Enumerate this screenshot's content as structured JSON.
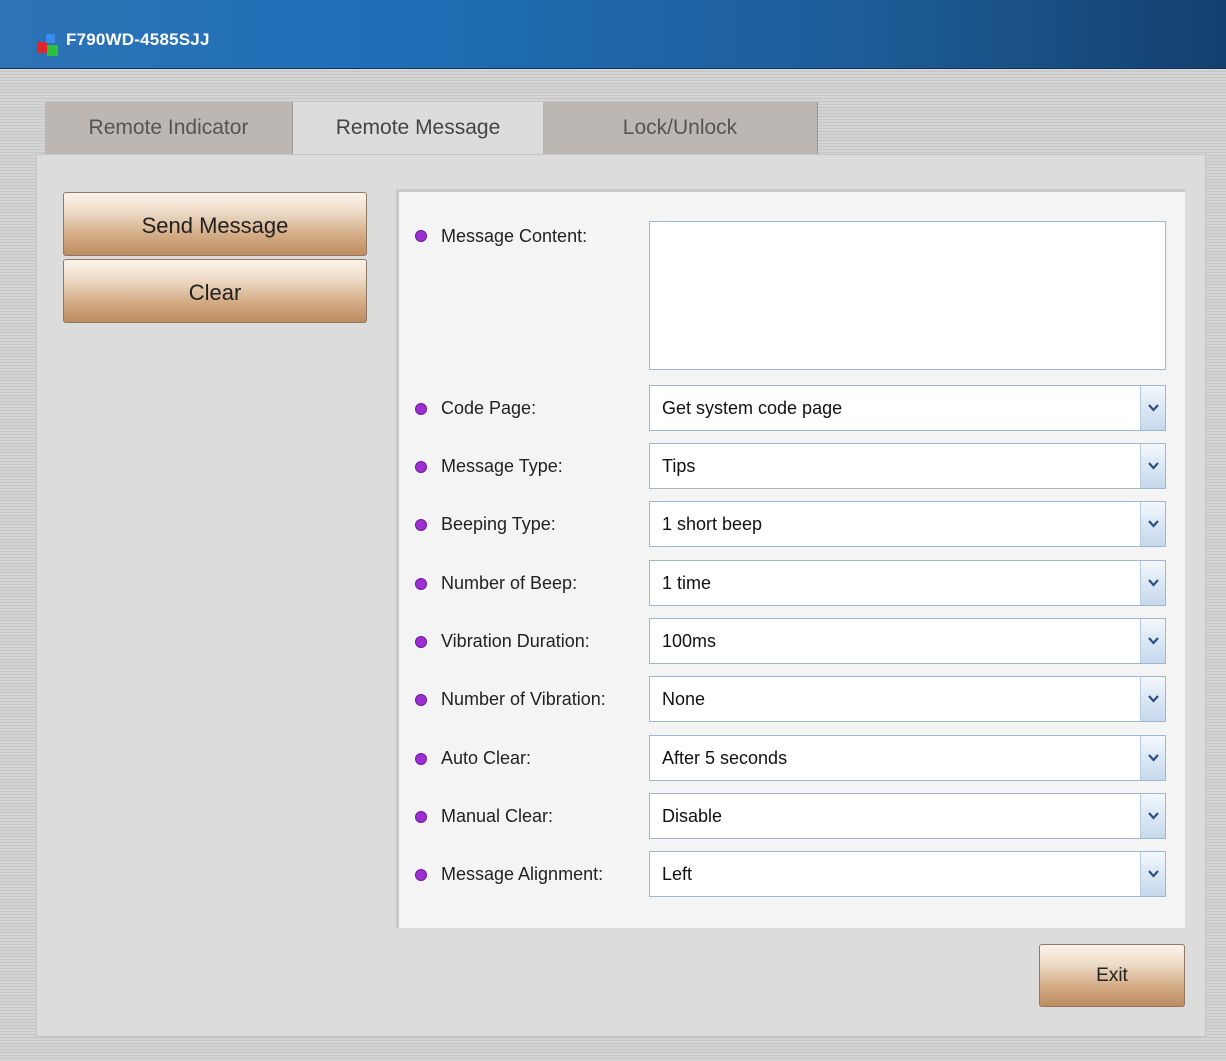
{
  "window": {
    "title": "F790WD-4585SJJ",
    "icon": "app-cubes-icon"
  },
  "tabs": [
    {
      "label": "Remote Indicator",
      "active": false
    },
    {
      "label": "Remote Message",
      "active": true
    },
    {
      "label": "Lock/Unlock",
      "active": false
    }
  ],
  "actions": {
    "send_label": "Send Message",
    "clear_label": "Clear"
  },
  "form": {
    "message_content": {
      "label": "Message Content:",
      "value": ""
    },
    "fields": [
      {
        "label": "Code Page:",
        "value": "Get system code page"
      },
      {
        "label": "Message Type:",
        "value": "Tips"
      },
      {
        "label": "Beeping Type:",
        "value": "1 short beep"
      },
      {
        "label": "Number of Beep:",
        "value": "1 time"
      },
      {
        "label": "Vibration Duration:",
        "value": "100ms"
      },
      {
        "label": "Number of Vibration:",
        "value": "None"
      },
      {
        "label": "Auto Clear:",
        "value": "After 5 seconds"
      },
      {
        "label": "Manual Clear:",
        "value": "Disable"
      },
      {
        "label": "Message Alignment:",
        "value": "Left"
      }
    ]
  },
  "footer": {
    "exit_label": "Exit"
  },
  "colors": {
    "titlebar": "#1f6fb8",
    "bullet": "#9b2fd1",
    "button_gradient_bottom": "#bd8d62",
    "tab_inactive": "#bdb7b4"
  }
}
